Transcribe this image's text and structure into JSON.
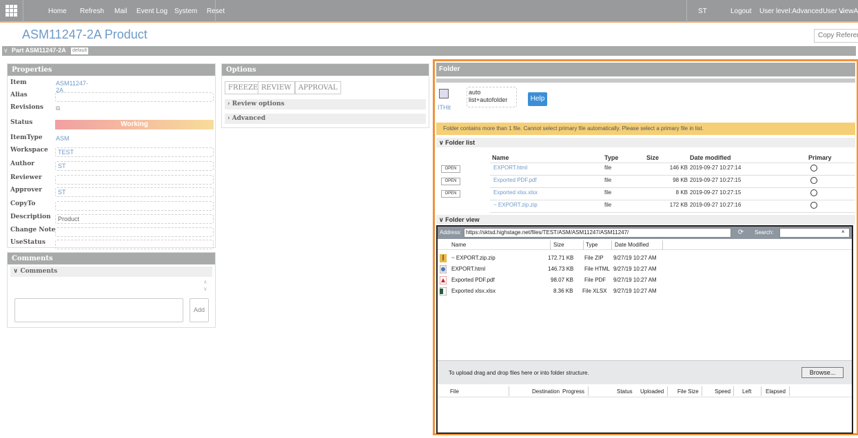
{
  "nav": {
    "items": [
      "Home",
      "Refresh",
      "Mail",
      "Event Log",
      "System",
      "Reset"
    ],
    "user": "ST",
    "logout": "Logout",
    "user_level": "User level:AdvancedUser",
    "view_as": "ViewAs:"
  },
  "page": {
    "title": "ASM11247-2A Product",
    "copy_ref": "Copy Referen",
    "part_label": "Part ASM11247-2A",
    "part_badge": "default"
  },
  "properties": {
    "header": "Properties",
    "item_label": "Item",
    "item_value": "ASM11247-2A",
    "alias_label": "Alias",
    "revisions_label": "Revisions",
    "status_label": "Status",
    "status_value": "Working",
    "itemtype_label": "ItemType",
    "itemtype_value": "ASM",
    "workspace_label": "Workspace",
    "workspace_value": "TEST",
    "author_label": "Author",
    "author_value": "ST",
    "reviewer_label": "Reviewer",
    "approver_label": "Approver",
    "approver_value": "ST",
    "copyto_label": "CopyTo",
    "description_label": "Description",
    "description_value": "Product",
    "changenote_label": "Change Note",
    "usestatus_label": "UseStatus"
  },
  "comments": {
    "header": "Comments",
    "section": "Comments",
    "add": "Add"
  },
  "options": {
    "header": "Options",
    "freeze": "FREEZE",
    "review": "REVIEW",
    "approval": "APPROVAL",
    "review_options": "Review options",
    "advanced": "Advanced"
  },
  "folder": {
    "header": "Folder",
    "ithit": "ITHit",
    "mode_line1": "auto",
    "mode_line2": "list+autofolder",
    "help": "Help",
    "warning": "Folder contains more than 1 file. Cannot select primary file automatically. Please select a primary file in list.",
    "list_header": "Folder list",
    "cols": {
      "name": "Name",
      "type": "Type",
      "size": "Size",
      "date": "Date modified",
      "primary": "Primary"
    },
    "open": "OPEN",
    "files": [
      {
        "name": "EXPORT.html",
        "type": "file",
        "size": "146 KB",
        "date": "2019-09-27 10:27:14"
      },
      {
        "name": "Exported PDF.pdf",
        "type": "file",
        "size": "98 KB",
        "date": "2019-09-27 10:27:15"
      },
      {
        "name": "Exported xlsx.xlsx",
        "type": "file",
        "size": "8 KB",
        "date": "2019-09-27 10:27:15"
      },
      {
        "name": "~ EXPORT.zip.zip",
        "type": "file",
        "size": "172 KB",
        "date": "2019-09-27 10:27:16"
      }
    ],
    "view_header": "Folder view"
  },
  "browser": {
    "address_label": "Address:",
    "address": "https://sktsd.highstage.net/files/TEST/ASM/ASM11247/ASM11247/",
    "search_label": "Search:",
    "search_clear": "×",
    "cols": {
      "name": "Name",
      "size": "Size",
      "type": "Type",
      "date": "Date Modified"
    },
    "files": [
      {
        "name": "~ EXPORT.zip.zip",
        "size": "172.71 KB",
        "type": "File ZIP",
        "date": "9/27/19 10:27 AM"
      },
      {
        "name": "EXPORT.html",
        "size": "146.73 KB",
        "type": "File HTML",
        "date": "9/27/19 10:27 AM"
      },
      {
        "name": "Exported PDF.pdf",
        "size": "98.07 KB",
        "type": "File PDF",
        "date": "9/27/19 10:27 AM"
      },
      {
        "name": "Exported xlsx.xlsx",
        "size": "8.36 KB",
        "type": "File XLSX",
        "date": "9/27/19 10:27 AM"
      }
    ],
    "upload_hint": "To upload drag and drop files here or into folder structure.",
    "browse": "Browse...",
    "upload_cols": [
      "File",
      "Destination",
      "Progress",
      "Status",
      "Uploaded",
      "File Size",
      "Speed",
      "Left",
      "Elapsed"
    ]
  }
}
